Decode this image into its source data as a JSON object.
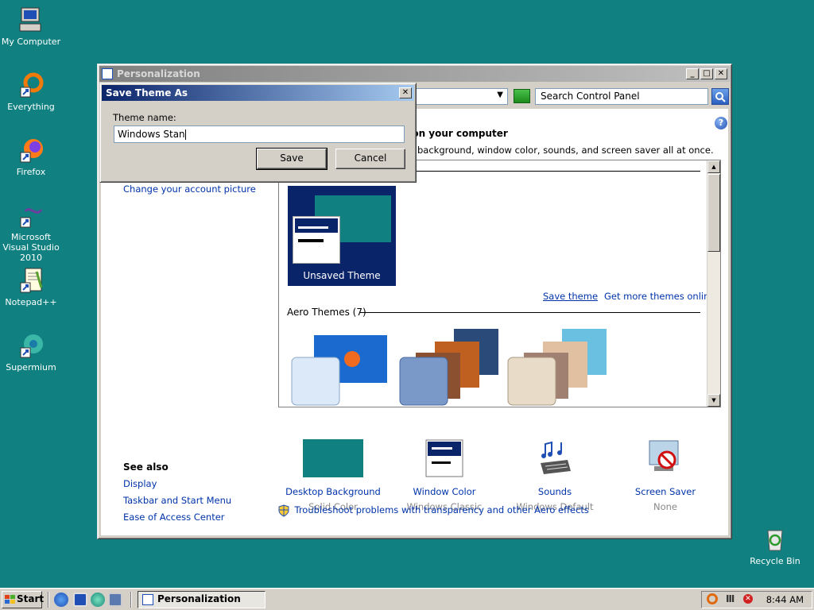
{
  "desktop": {
    "icons": [
      {
        "label": "My Computer",
        "icon": "my-computer-icon"
      },
      {
        "label": "Everything",
        "icon": "everything-icon"
      },
      {
        "label": "Firefox",
        "icon": "firefox-icon"
      },
      {
        "label": "Microsoft Visual Studio 2010",
        "icon": "visual-studio-icon"
      },
      {
        "label": "Notepad++",
        "icon": "notepad-plus-plus-icon"
      },
      {
        "label": "Supermium",
        "icon": "supermium-icon"
      },
      {
        "label": "Recycle Bin",
        "icon": "recycle-bin-icon"
      }
    ],
    "background_color": "#108080"
  },
  "personalization": {
    "title": "Personalization",
    "search_placeholder": "Search Control Panel",
    "heading": "s on your computer",
    "subheading": "background, window color, sounds, and screen saver all at once.",
    "left_links": {
      "change_account_picture": "Change your account picture"
    },
    "see_also": {
      "title": "See also",
      "links": [
        "Display",
        "Taskbar and Start Menu",
        "Ease of Access Center"
      ]
    },
    "themes": {
      "unsaved_label": "Unsaved Theme",
      "save_theme": "Save theme",
      "get_more": "Get more themes online",
      "aero_header": "Aero Themes (7)"
    },
    "bottom_items": [
      {
        "name": "Desktop Background",
        "value": "Solid Color",
        "icon": "desktop-background-icon"
      },
      {
        "name": "Window Color",
        "value": "Windows Classic",
        "icon": "window-color-icon"
      },
      {
        "name": "Sounds",
        "value": "Windows Default",
        "icon": "sounds-icon"
      },
      {
        "name": "Screen Saver",
        "value": "None",
        "icon": "screen-saver-icon"
      }
    ],
    "troubleshoot": "Troubleshoot problems with transparency and other Aero effects",
    "colors": {
      "accent": "#0a246a",
      "link": "#0033aa",
      "swatch": "#108080"
    }
  },
  "dialog": {
    "title": "Save Theme As",
    "label": "Theme name:",
    "value": "Windows Stan",
    "save_label": "Save",
    "cancel_label": "Cancel"
  },
  "taskbar": {
    "start_label": "Start",
    "task_label": "Personalization",
    "clock": "8:44 AM"
  }
}
